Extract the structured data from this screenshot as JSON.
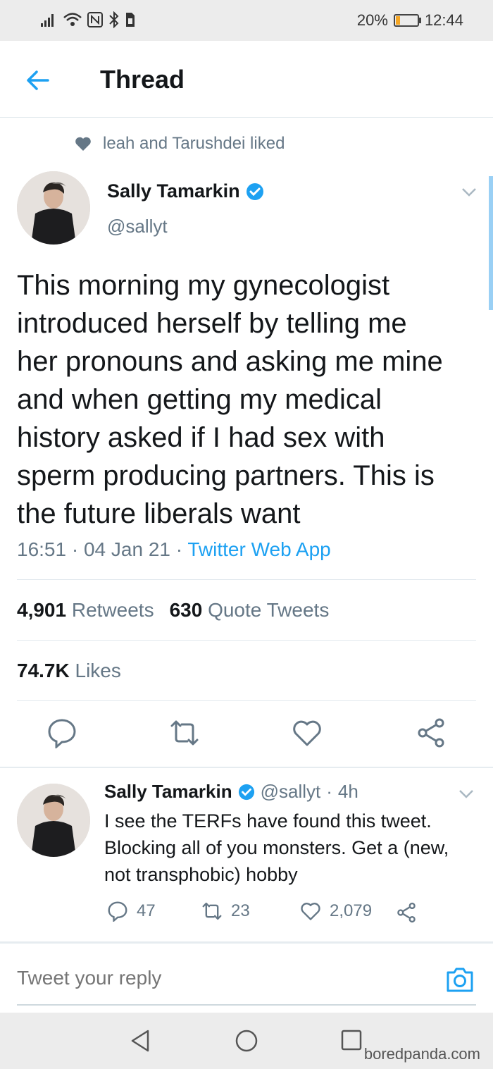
{
  "status_bar": {
    "battery": "20%",
    "battery_level": 0.2,
    "time": "12:44",
    "icons": [
      "signal-icon",
      "wifi-icon",
      "nfc-icon",
      "bluetooth-icon",
      "sim-icon"
    ]
  },
  "header": {
    "title": "Thread",
    "back_icon": "arrow-left-icon"
  },
  "social_context": {
    "text": "leah and Tarushdei liked",
    "icon": "heart-icon"
  },
  "tweet": {
    "name": "Sally Tamarkin",
    "handle": "@sallyt",
    "verified": true,
    "text_lines": [
      "This morning my gynecologist",
      "introduced herself by telling me",
      "her pronouns and asking me mine",
      "and when getting my medical",
      "history asked if I had sex with",
      "sperm producing partners. This is",
      "the future liberals want"
    ],
    "time": "16:51",
    "date": "04 Jan 21",
    "source": "Twitter Web App",
    "retweets": "4,901",
    "retweets_label": "Retweets",
    "quotes": "630",
    "quotes_label": "Quote Tweets",
    "likes": "74.7K",
    "likes_label": "Likes"
  },
  "reply": {
    "name": "Sally Tamarkin",
    "handle": "@sallyt",
    "age": "4h",
    "text_lines": [
      "I see the TERFs have found this tweet.",
      "Blocking all of you monsters. Get a (new,",
      "not transphobic) hobby"
    ],
    "replies": "47",
    "retweets": "23",
    "likes": "2,079"
  },
  "composer": {
    "placeholder": "Tweet your reply",
    "icon": "camera-icon"
  },
  "watermark": "boredpanda.com",
  "colors": {
    "accent": "#1da1f2",
    "secondary_text": "#657786",
    "battery": "#f5a623"
  }
}
